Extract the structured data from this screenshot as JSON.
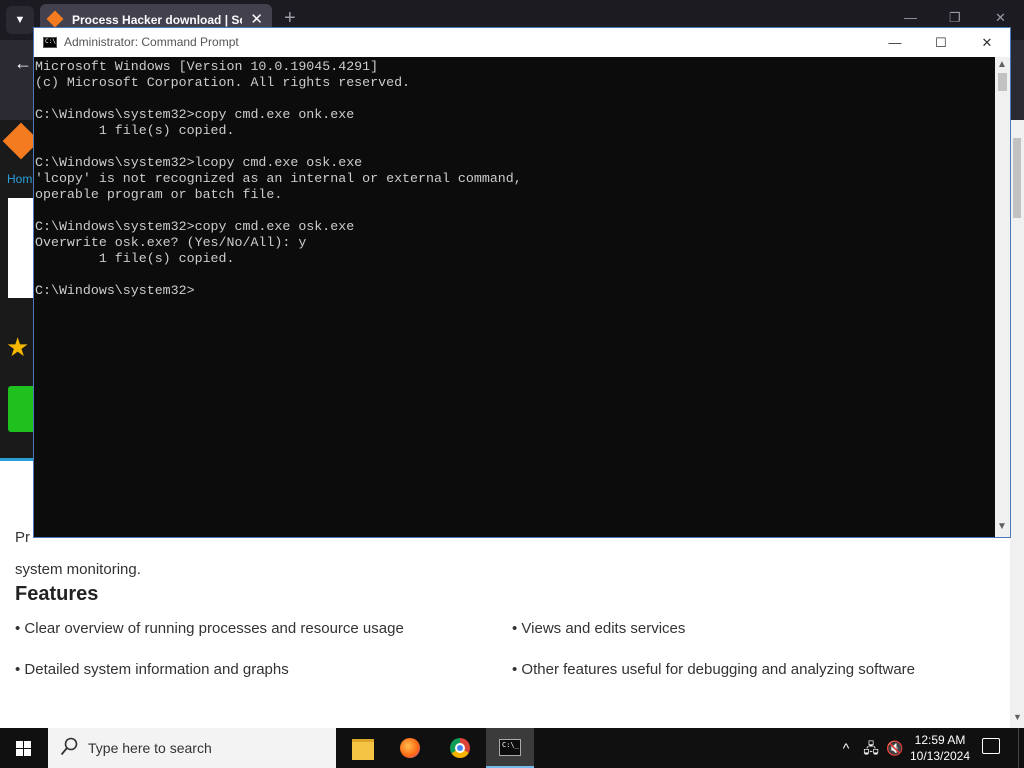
{
  "browser": {
    "tab_title": "Process Hacker download | So",
    "tab_close": "✕",
    "new_tab": "+",
    "minimize": "—",
    "restore": "❐",
    "close": "✕",
    "home_link": "Hom"
  },
  "page": {
    "desc_line1": "Pr",
    "desc_line2": "system monitoring.",
    "features_heading": "Features",
    "features": [
      "• Clear overview of running processes and resource usage",
      "• Views and edits services",
      "• Detailed system information and graphs",
      "• Other features useful for debugging and analyzing software"
    ]
  },
  "cmd": {
    "title": "Administrator: Command Prompt",
    "icon_text": "C:\\",
    "minimize": "—",
    "maximize": "☐",
    "close": "✕",
    "lines": [
      "Microsoft Windows [Version 10.0.19045.4291]",
      "(c) Microsoft Corporation. All rights reserved.",
      "",
      "C:\\Windows\\system32>copy cmd.exe onk.exe",
      "        1 file(s) copied.",
      "",
      "C:\\Windows\\system32>lcopy cmd.exe osk.exe",
      "'lcopy' is not recognized as an internal or external command,",
      "operable program or batch file.",
      "",
      "C:\\Windows\\system32>copy cmd.exe osk.exe",
      "Overwrite osk.exe? (Yes/No/All): y",
      "        1 file(s) copied.",
      "",
      "C:\\Windows\\system32>"
    ]
  },
  "taskbar": {
    "search_placeholder": "Type here to search",
    "time": "12:59 AM",
    "date": "10/13/2024",
    "pinned": [
      "file-explorer",
      "firefox",
      "chrome",
      "command-prompt"
    ],
    "active_app": "command-prompt"
  }
}
